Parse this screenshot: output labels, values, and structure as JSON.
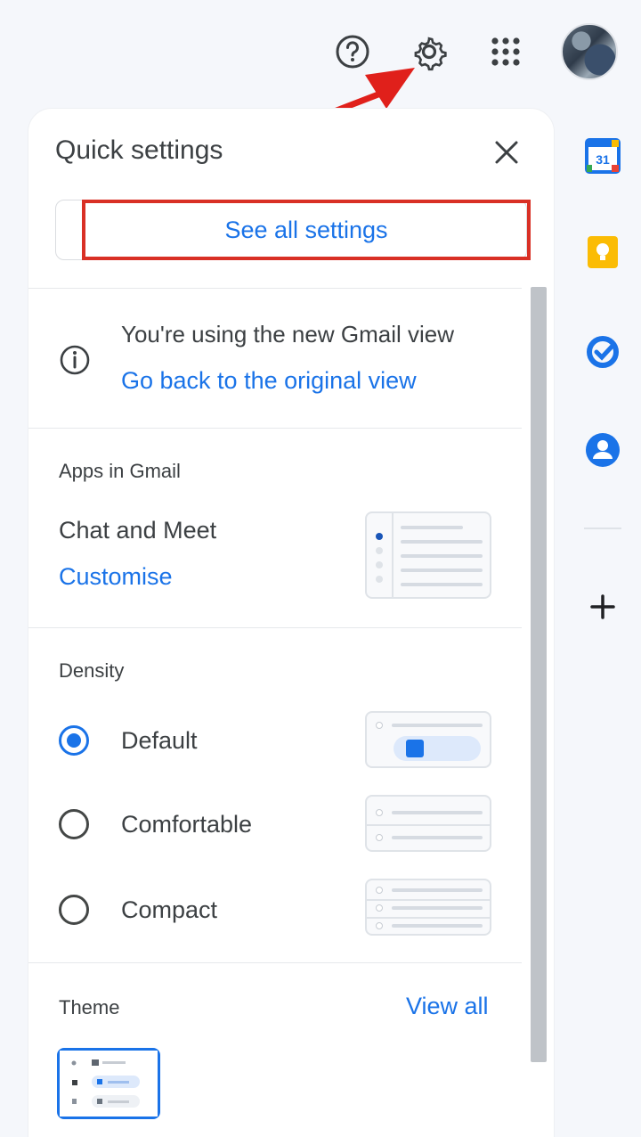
{
  "panel": {
    "title": "Quick settings",
    "see_all_settings": "See all settings",
    "info": {
      "text": "You're using the new Gmail view",
      "link": "Go back to the original view"
    },
    "apps_in_gmail": {
      "heading": "Apps in Gmail",
      "item": "Chat and Meet",
      "link": "Customise"
    },
    "density": {
      "heading": "Density",
      "options": [
        {
          "label": "Default",
          "selected": true
        },
        {
          "label": "Comfortable",
          "selected": false
        },
        {
          "label": "Compact",
          "selected": false
        }
      ]
    },
    "theme": {
      "heading": "Theme",
      "link": "View all"
    }
  },
  "icons": {
    "help": "help-icon",
    "settings": "gear-icon",
    "apps": "apps-grid-icon",
    "close": "close-icon",
    "info": "info-icon"
  },
  "rail": [
    "calendar-icon",
    "keep-icon",
    "tasks-icon",
    "contacts-icon",
    "add-icon"
  ],
  "colors": {
    "accent": "#1a73e8",
    "highlight": "#d93025"
  }
}
